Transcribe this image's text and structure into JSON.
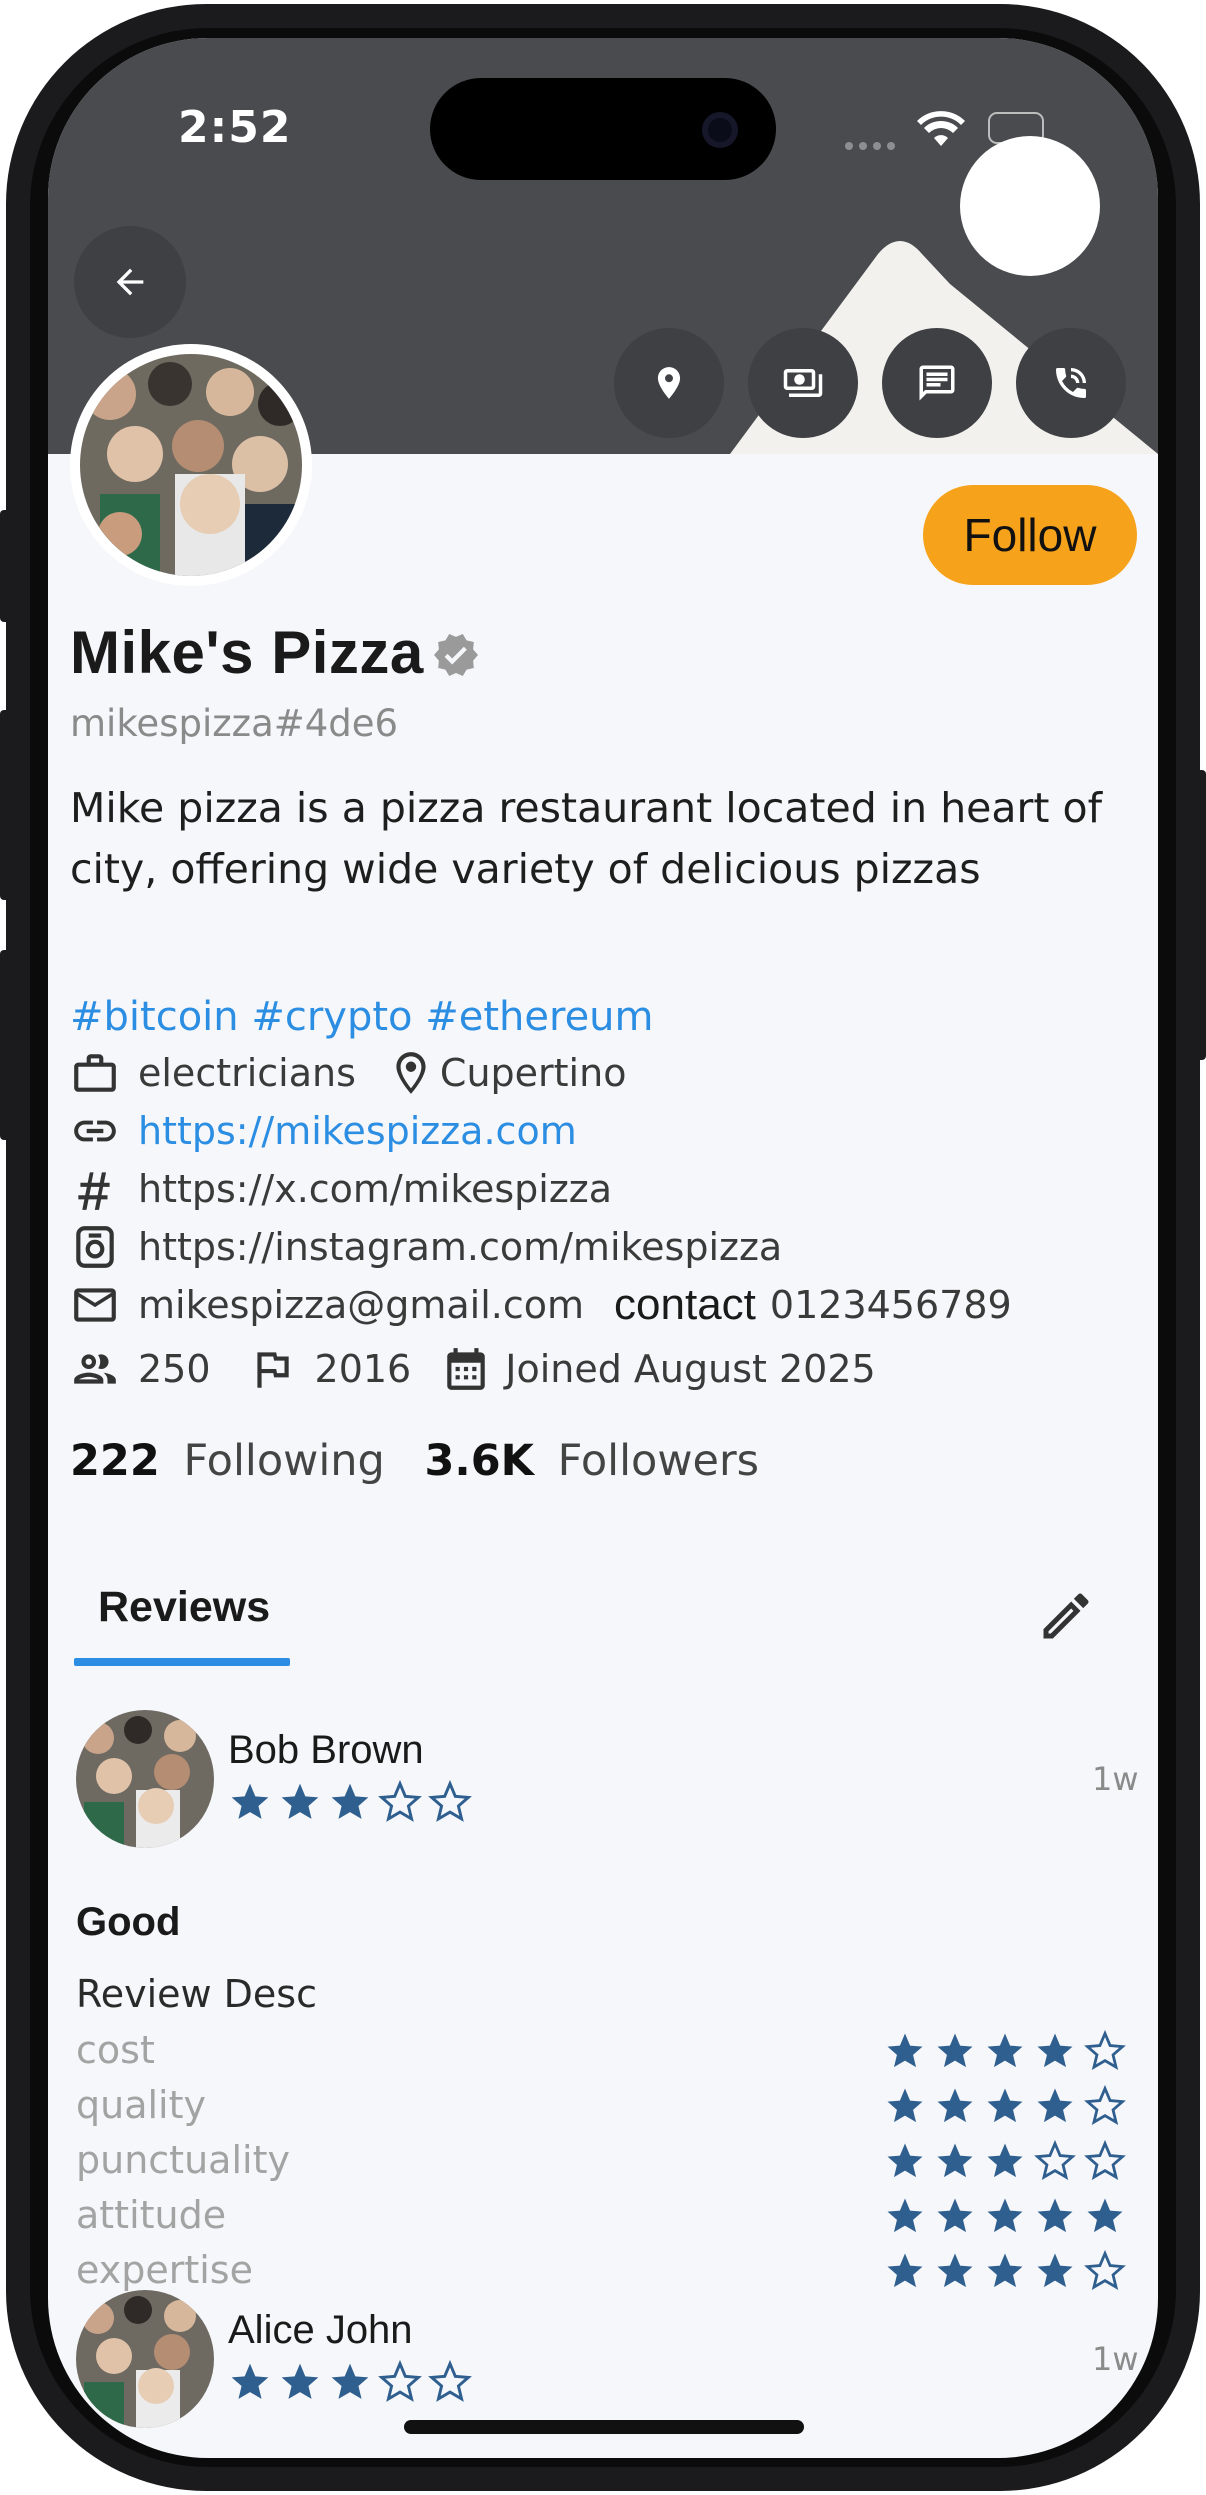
{
  "status_bar": {
    "time": "2:52"
  },
  "profile": {
    "name": "Mike's Pizza",
    "handle": "mikespizza#4de6",
    "bio": "Mike pizza is a pizza restaurant located in heart of city, offering wide variety of delicious pizzas",
    "tags": "#bitcoin #crypto #ethereum",
    "category": "electricians",
    "location": "Cupertino",
    "website": "https://mikespizza.com",
    "x_link": "https://x.com/mikespizza",
    "instagram": "https://instagram.com/mikespizza",
    "email": "mikespizza@gmail.com",
    "contact_label": "contact",
    "contact_number": "0123456789",
    "employees": "250",
    "founded": "2016",
    "joined": "Joined August 2025",
    "following_count": "222",
    "following_label": "Following",
    "followers_count": "3.6K",
    "followers_label": "Followers",
    "follow_button": "Follow"
  },
  "header_actions": [
    "location-icon",
    "payment-icon",
    "message-icon",
    "phone-icon"
  ],
  "tabs": [
    {
      "label": "Reviews"
    }
  ],
  "reviews": [
    {
      "author": "Bob Brown",
      "rating": 3,
      "time": "1w",
      "title": "Good",
      "description": "Review Desc",
      "criteria": [
        {
          "label": "cost",
          "rating": 4
        },
        {
          "label": "quality",
          "rating": 4
        },
        {
          "label": "punctuality",
          "rating": 3
        },
        {
          "label": "attitude",
          "rating": 5
        },
        {
          "label": "expertise",
          "rating": 4
        }
      ]
    },
    {
      "author": "Alice John",
      "rating": 3,
      "time": "1w"
    }
  ],
  "colors": {
    "accent": "#2c8ee2",
    "follow_button": "#f7a21b",
    "star": "#2f5f8f",
    "header": "#4a4b4f"
  }
}
